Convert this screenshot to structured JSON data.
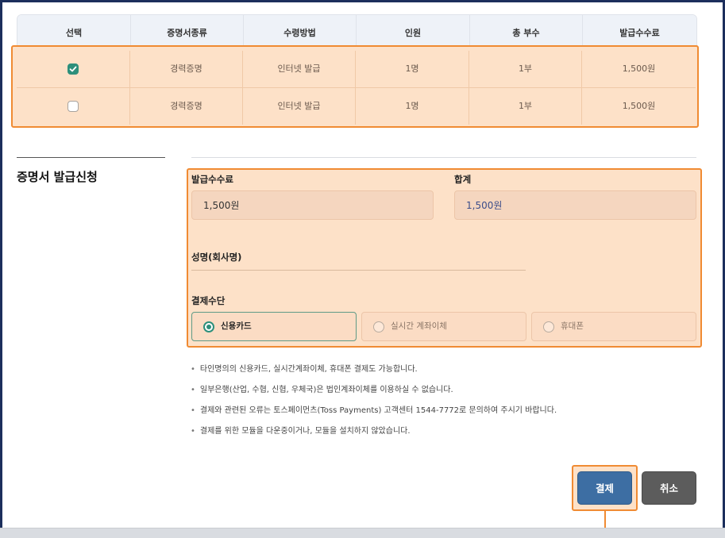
{
  "table": {
    "headers": [
      "선택",
      "증명서종류",
      "수령방법",
      "인원",
      "총 부수",
      "발급수수료"
    ],
    "rows": [
      {
        "selected": true,
        "cert_type": "경력증명",
        "receive_method": "인터넷 발급",
        "persons": "1명",
        "copies": "1부",
        "fee": "1,500원"
      },
      {
        "selected": false,
        "cert_type": "경력증명",
        "receive_method": "인터넷 발급",
        "persons": "1명",
        "copies": "1부",
        "fee": "1,500원"
      }
    ]
  },
  "section": {
    "title": "증명서 발급신청"
  },
  "form": {
    "fee_label": "발급수수료",
    "fee_value": "1,500원",
    "total_label": "합계",
    "total_value": "1,500원",
    "name_label": "성명(회사명)",
    "name_value": "",
    "payment_label": "결제수단",
    "payment_options": [
      {
        "label": "신용카드",
        "selected": true
      },
      {
        "label": "실시간 계좌이체",
        "selected": false
      },
      {
        "label": "휴대폰",
        "selected": false
      }
    ]
  },
  "notes": [
    "타인명의의 신용카드, 실시간계좌이체, 휴대폰 결제도 가능합니다.",
    "일부은행(산업, 수협, 신협, 우체국)은 법인계좌이체를 이용하실 수 없습니다.",
    "결제와 관련된 오류는 토스페이먼츠(Toss Payments) 고객센터 1544-7772로 문의하여 주시기 바랍니다.",
    "결제를 위한 모듈을 다운중이거나, 모듈을 설치하지 않았습니다."
  ],
  "buttons": {
    "pay": "결제",
    "cancel": "취소"
  },
  "colors": {
    "highlight_border": "#f08b33",
    "highlight_fill": "#fde1c8",
    "accent_green": "#2d8f7b",
    "pay_button": "#3d6ea3",
    "cancel_button": "#5c5c5c",
    "frame": "#1c2f5c"
  }
}
